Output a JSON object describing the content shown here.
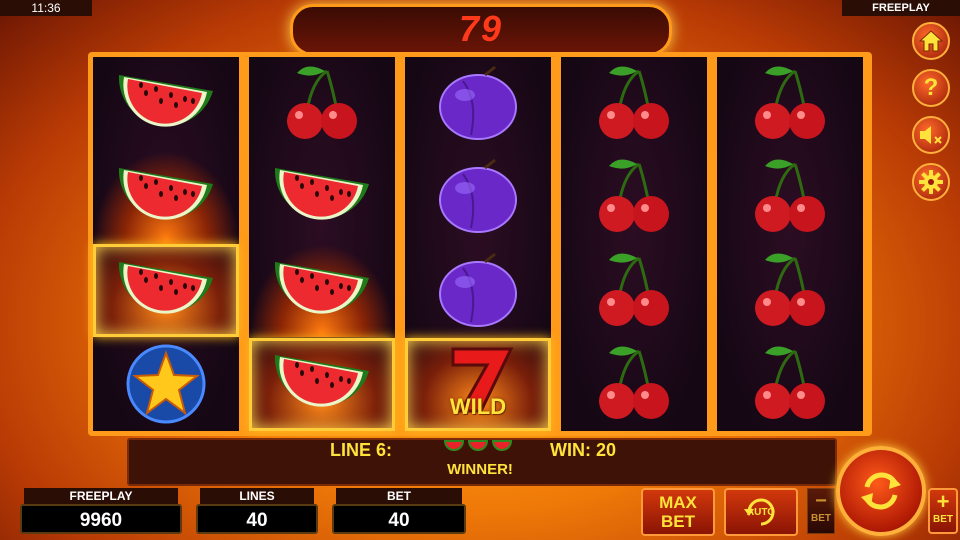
{
  "status_bar": {
    "time": "11:36",
    "mode": "FREEPLAY"
  },
  "jackpot": {
    "value": "79"
  },
  "reels": [
    [
      {
        "symbol": "watermelon"
      },
      {
        "symbol": "watermelon",
        "effect": "fire"
      },
      {
        "symbol": "watermelon",
        "effect": "fire",
        "winning": true
      },
      {
        "symbol": "star"
      }
    ],
    [
      {
        "symbol": "cherry"
      },
      {
        "symbol": "watermelon"
      },
      {
        "symbol": "watermelon",
        "effect": "fire"
      },
      {
        "symbol": "watermelon",
        "effect": "fire",
        "winning": true
      }
    ],
    [
      {
        "symbol": "plum"
      },
      {
        "symbol": "plum"
      },
      {
        "symbol": "plum"
      },
      {
        "symbol": "seven",
        "label": "WILD",
        "winning": true
      }
    ],
    [
      {
        "symbol": "cherry"
      },
      {
        "symbol": "cherry"
      },
      {
        "symbol": "cherry"
      },
      {
        "symbol": "cherry"
      }
    ],
    [
      {
        "symbol": "cherry"
      },
      {
        "symbol": "cherry"
      },
      {
        "symbol": "cherry"
      },
      {
        "symbol": "cherry"
      }
    ]
  ],
  "win_panel": {
    "line_label": "LINE 6:",
    "line_symbols": [
      "watermelon-icon",
      "watermelon-icon",
      "watermelon-icon"
    ],
    "win_label": "WIN: 20",
    "winner_text": "WINNER!"
  },
  "stats": {
    "freeplay": {
      "label": "FREEPLAY",
      "value": "9960"
    },
    "lines": {
      "label": "LINES",
      "value": "40"
    },
    "bet": {
      "label": "BET",
      "value": "40"
    }
  },
  "controls": {
    "max_bet_top": "MAX",
    "max_bet_bottom": "BET",
    "auto_label": "AUTO",
    "bet_minus_symbol": "−",
    "bet_minus_label": "BET",
    "bet_plus_symbol": "+",
    "bet_plus_label": "BET"
  },
  "side_buttons": [
    "home-icon",
    "help-icon",
    "sound-muted-icon",
    "settings-icon"
  ],
  "side_button_glyphs": {
    "help": "?"
  },
  "colors": {
    "accent_yellow": "#ffe23a",
    "frame_orange": "#ff9a1a",
    "reel_bg": "#1a0818"
  }
}
